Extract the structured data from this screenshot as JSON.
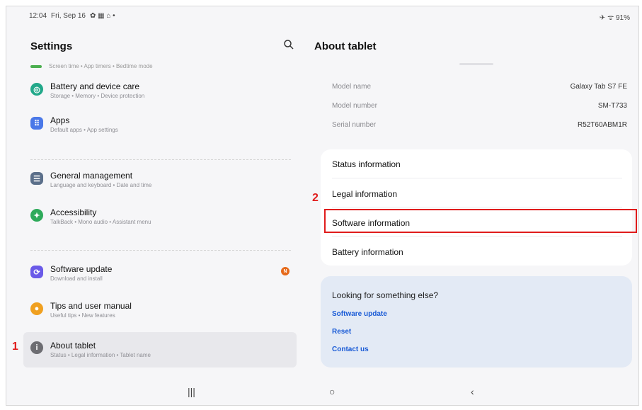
{
  "status": {
    "time": "12:04",
    "date": "Fri, Sep 16",
    "right": "✈ ᯤ 91%"
  },
  "left": {
    "title": "Settings",
    "scroll_hint": "Screen time • App timers • Bedtime mode",
    "items": [
      {
        "title": "Battery and device care",
        "sub": "Storage • Memory • Device protection",
        "color": "#22a88a",
        "icon": "battery-care-icon"
      },
      {
        "title": "Apps",
        "sub": "Default apps • App settings",
        "color": "#4a78e8",
        "icon": "apps-icon"
      },
      {
        "title": "General management",
        "sub": "Language and keyboard • Date and time",
        "color": "#5b6f8a",
        "icon": "general-management-icon"
      },
      {
        "title": "Accessibility",
        "sub": "TalkBack • Mono audio • Assistant menu",
        "color": "#2eaa5a",
        "icon": "accessibility-icon"
      },
      {
        "title": "Software update",
        "sub": "Download and install",
        "color": "#6a5ae8",
        "icon": "software-update-icon",
        "badge": "N"
      },
      {
        "title": "Tips and user manual",
        "sub": "Useful tips • New features",
        "color": "#f0a020",
        "icon": "tips-icon"
      },
      {
        "title": "About tablet",
        "sub": "Status • Legal information • Tablet name",
        "color": "#6d6d72",
        "icon": "about-icon"
      }
    ],
    "annotation": "1"
  },
  "right": {
    "title": "About tablet",
    "info": [
      {
        "label": "Model name",
        "value": "Galaxy Tab S7 FE"
      },
      {
        "label": "Model number",
        "value": "SM-T733"
      },
      {
        "label": "Serial number",
        "value": "R52T60ABM1R"
      }
    ],
    "rows": [
      "Status information",
      "Legal information",
      "Software information",
      "Battery information"
    ],
    "annotation": "2",
    "looking": {
      "heading": "Looking for something else?",
      "links": [
        "Software update",
        "Reset",
        "Contact us"
      ]
    }
  },
  "nav": {
    "recents": "|||",
    "home": "○",
    "back": "‹"
  },
  "colors": {
    "annotation": "#e01c1c",
    "link": "#1a5bd6"
  }
}
